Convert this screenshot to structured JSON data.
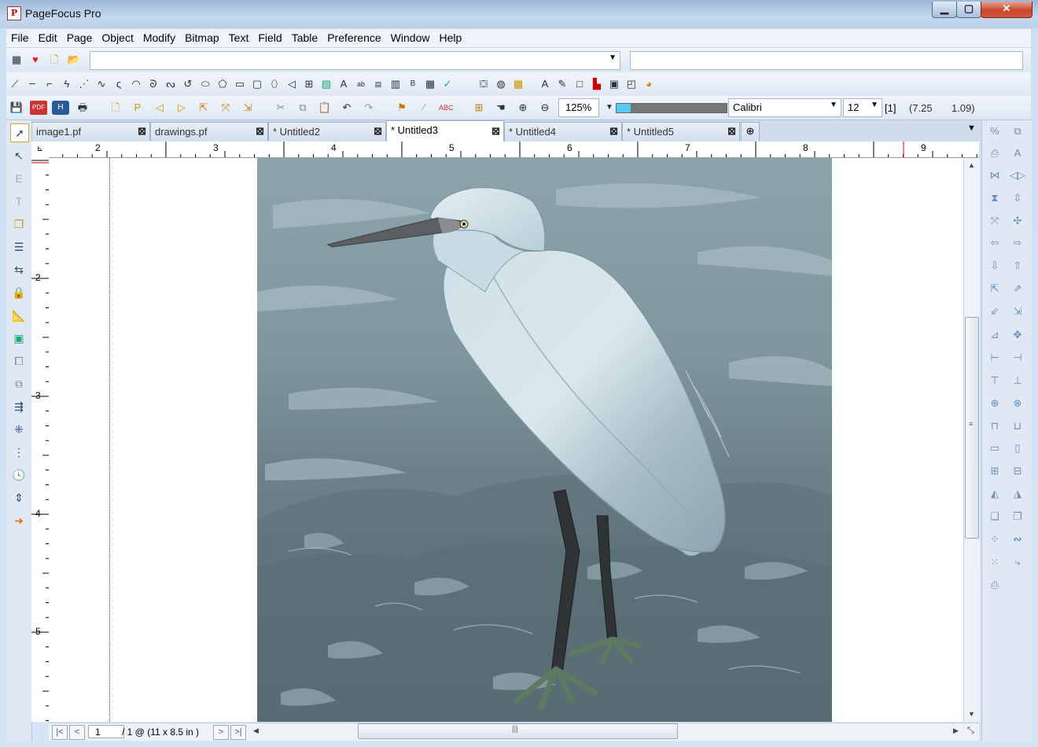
{
  "window": {
    "title": "PageFocus Pro",
    "icon_letter": "P"
  },
  "menu": [
    "File",
    "Edit",
    "Page",
    "Object",
    "Modify",
    "Bitmap",
    "Text",
    "Field",
    "Table",
    "Preference",
    "Window",
    "Help"
  ],
  "toolbar": {
    "zoom": "125%",
    "font": "Calibri",
    "font_size": "12",
    "page_indicator": "[1]",
    "cursor_x": "(7.25",
    "cursor_y": "1.09)"
  },
  "tabs": [
    {
      "label": "image1.pf",
      "active": false
    },
    {
      "label": "drawings.pf",
      "active": false
    },
    {
      "label": "* Untitled2",
      "active": false
    },
    {
      "label": "* Untitled3",
      "active": true
    },
    {
      "label": "* Untitled4",
      "active": false
    },
    {
      "label": "* Untitled5",
      "active": false
    }
  ],
  "rulers": {
    "h": [
      "2",
      "3",
      "4",
      "5",
      "6",
      "7",
      "8",
      "9"
    ],
    "v": [
      "2",
      "3",
      "4",
      "5"
    ]
  },
  "status": {
    "page": "1",
    "page_info": "/ 1 @ (11 x 8.5 in )"
  },
  "icons": {
    "min": "minimize-icon",
    "max": "maximize-icon",
    "close": "close-icon"
  }
}
